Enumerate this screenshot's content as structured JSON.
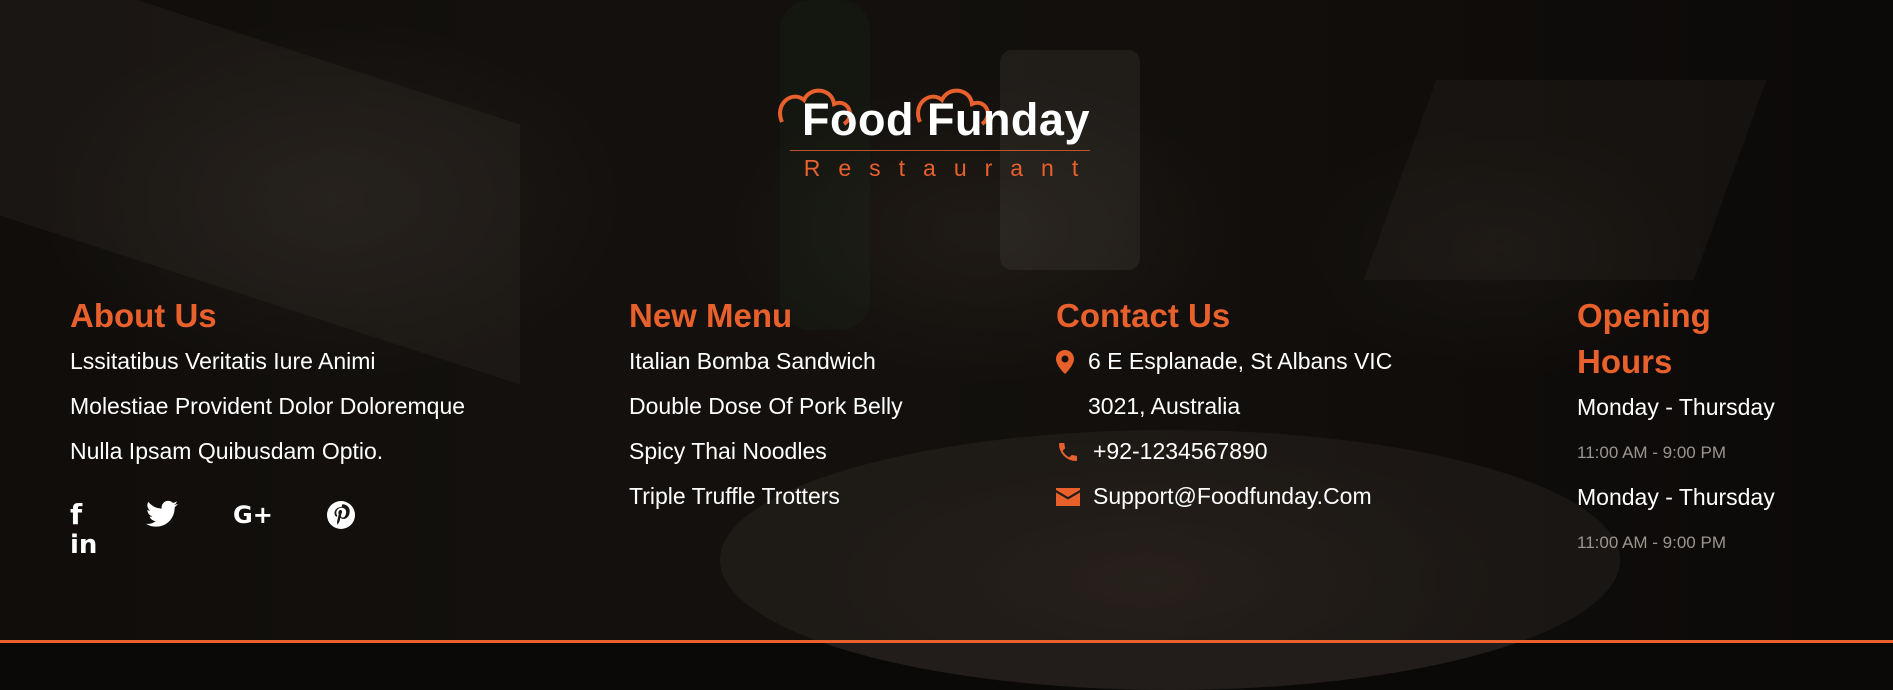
{
  "logo": {
    "name": "Food Funday",
    "tagline": "Restaurant"
  },
  "about": {
    "title": "About Us",
    "lines": [
      "Lssitatibus Veritatis Iure Animi",
      "Molestiae Provident Dolor Doloremque",
      "Nulla Ipsam Quibusdam Optio."
    ],
    "social": [
      "facebook-icon",
      "twitter-icon",
      "google-plus-icon",
      "pinterest-icon",
      "linkedin-icon"
    ]
  },
  "menu": {
    "title": "New Menu",
    "items": [
      "Italian Bomba Sandwich",
      "Double Dose Of Pork Belly",
      "Spicy Thai Noodles",
      "Triple Truffle Trotters"
    ]
  },
  "contact": {
    "title": "Contact Us",
    "address_line1": "6 E Esplanade, St Albans VIC",
    "address_line2": "3021, Australia",
    "phone": "+92-1234567890",
    "email": "Support@Foodfunday.Com"
  },
  "hours": {
    "title_line1": "Opening",
    "title_line2": "Hours",
    "entries": [
      {
        "day": "Monday - Thursday",
        "time": "11:00 AM - 9:00 PM"
      },
      {
        "day": "Monday - Thursday",
        "time": "11:00 AM - 9:00 PM"
      }
    ]
  },
  "colors": {
    "accent": "#e8602c",
    "text": "#ffffff",
    "muted": "#9b9590"
  }
}
